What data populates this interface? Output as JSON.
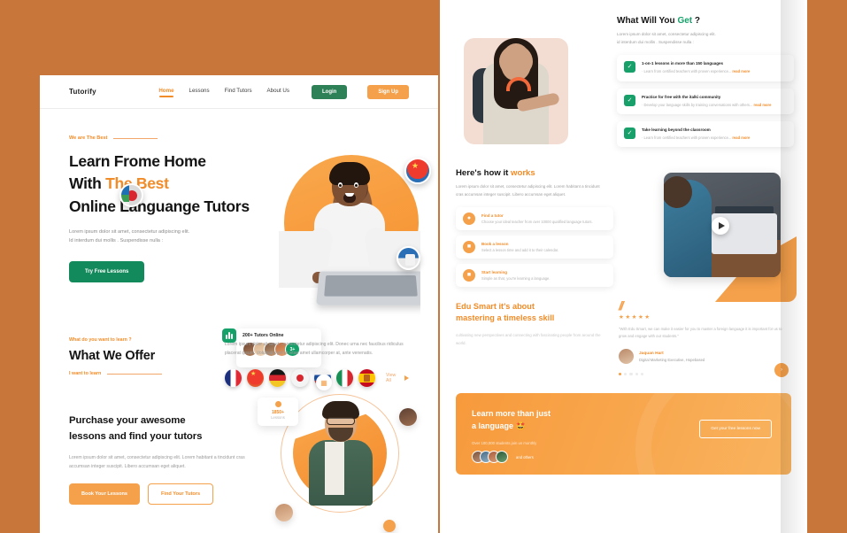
{
  "brand": {
    "name": "Tutorify",
    "accent": "#F28C28",
    "green": "#17a06a"
  },
  "nav": {
    "links": [
      {
        "label": "Home",
        "active": true
      },
      {
        "label": "Lessons",
        "active": false
      },
      {
        "label": "Find Tutors",
        "active": false
      },
      {
        "label": "About Us",
        "active": false
      }
    ],
    "login_label": "Login",
    "signup_label": "Sign Up"
  },
  "hero": {
    "eyebrow": "We are The Best",
    "title_line1": "Learn Frome Home",
    "title_line2_a": "With ",
    "title_line2_b": "The Best",
    "title_line3": "Online Languange Tutors",
    "subtitle_line1": "Lorem ipsum dolor sit amet, consectetur adipiscing elit.",
    "subtitle_line2": "Id interdum dui mollis . Suspendisse nulla :",
    "cta_label": "Try Free Lessons",
    "tutors_badge": {
      "title": "200+ Tutors Online",
      "more_count": "3+"
    }
  },
  "offer": {
    "question": "What do you want to learn ?",
    "title": "What We Offer",
    "want_label": "I want to learn",
    "description": "Lorem ipsum dolor sit amet, consectetur adipiscing elit. Donec urna nec faucibus ridiculus placerat ipsum. Volutpat eget ut vitae amet ullamcorper at, ante venenatis.",
    "languages": [
      "France",
      "China",
      "Germany",
      "Japan",
      "Russia",
      "Italy",
      "Spain"
    ],
    "view_all_label": "View All"
  },
  "purchase": {
    "title_line1": "Purchase your awesome",
    "title_line2": "lessons and find your tutors",
    "description": "Lorem ipsum dolor sit amet, consectetur adipiscing elit. Lorem habitant a tincidunt cras accumsan integer suscipit. Libero accumsan eget aliquet.",
    "book_label": "Book Your Lessons",
    "find_label": "Find Your Tutors",
    "mini_badge": {
      "value": "1850+",
      "label": "Lessons"
    }
  },
  "get_section": {
    "title_a": "What Will You ",
    "title_b": "Get",
    "title_c": " ?",
    "subtitle_line1": "Lorem ipsum dolor sit amet, consectetur adipiscing elit.",
    "subtitle_line2": "id interdum dui mollis . Suspendisse nulla :",
    "features": [
      {
        "title": "1-on-1 lessons in more than 150 languages",
        "desc": "Learn from certified teachers with proven experience...",
        "read_more": "read more"
      },
      {
        "title": "Practice for free with the italki community",
        "desc": "Develop your language skills by training conversations with others...",
        "read_more": "read more"
      },
      {
        "title": "Take learning beyond the classroom",
        "desc": "Learn from certified teachers with proven experience...",
        "read_more": "read more"
      }
    ]
  },
  "how_it_works": {
    "title_a": "Here's how it ",
    "title_b": "works",
    "description": "Lorem ipsum dolor sit amet, consectetur adipiscing elit. Lorem habitant a tincidunt cras accumsan integer suscipit. Libero accumsan eget aliquet.",
    "steps": [
      {
        "icon": "user-icon",
        "title": "Find a tutor",
        "desc": "Choose your ideal teacher from over 10000 qualified language tutors."
      },
      {
        "icon": "calendar-icon",
        "title": "Book a lesson",
        "desc": "Select a lesson time and add it to their calendar."
      },
      {
        "icon": "play-square-icon",
        "title": "Start learning",
        "desc": "Simple as that, you're learning a language."
      }
    ],
    "play_label": "play"
  },
  "edu": {
    "title_line1": "Edu Smart it's about",
    "title_line2": "mastering a timeless skill",
    "description": "cultivating new perspectives and connecting with fascinating people from around the world."
  },
  "testimonial": {
    "quote_mark": "//",
    "stars": "★★★★★",
    "text": "\"With Edu Smart, we can make it easier for you to master a foreign language it is important for us to grow and engage with our students.\"",
    "author": "Jaquan Hart",
    "role": "Digital Marketing Executive, Hopebased",
    "next_label": "›",
    "dots_total": 5,
    "dot_active": 1
  },
  "cta": {
    "title_line1": "Learn more than just",
    "title_line2": "a language",
    "emoji": "🤩",
    "students_note": "Over 100,000 students join us monthly",
    "others_label": "and others",
    "button_label": "Get your free lessons now"
  }
}
